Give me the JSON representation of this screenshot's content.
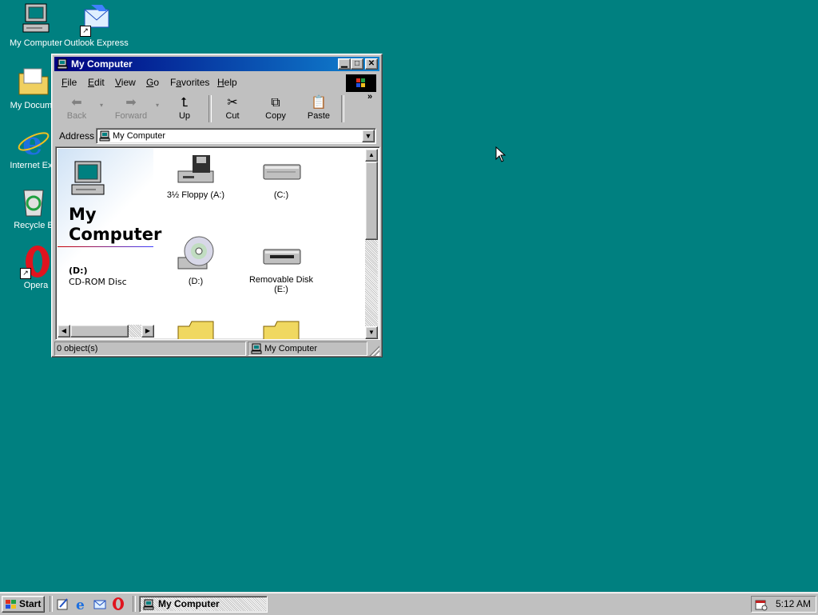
{
  "desktop": {
    "icons": [
      {
        "label": "My Computer",
        "icon": "my-computer-icon"
      },
      {
        "label": "Outlook Express",
        "icon": "outlook-express-icon"
      },
      {
        "label": "My Docume",
        "icon": "my-documents-icon"
      },
      {
        "label": "Internet Exp",
        "icon": "internet-explorer-icon"
      },
      {
        "label": "Recycle B",
        "icon": "recycle-bin-icon"
      },
      {
        "label": "Opera",
        "icon": "opera-icon"
      }
    ]
  },
  "window": {
    "title": "My Computer",
    "menu": [
      "File",
      "Edit",
      "View",
      "Go",
      "Favorites",
      "Help"
    ],
    "menu_underline": [
      "F",
      "E",
      "V",
      "G",
      "a",
      "H"
    ],
    "toolbar": {
      "back": "Back",
      "forward": "Forward",
      "up": "Up",
      "cut": "Cut",
      "copy": "Copy",
      "paste": "Paste",
      "more": "»"
    },
    "address": {
      "label": "Address",
      "value": "My Computer"
    },
    "left_pane": {
      "title": "My Computer",
      "selected_name": "(D:)",
      "selected_desc": "CD-ROM Disc"
    },
    "items": [
      {
        "label": "3½ Floppy (A:)",
        "icon": "floppy-drive-icon"
      },
      {
        "label": "(C:)",
        "icon": "hard-drive-icon"
      },
      {
        "label": "(D:)",
        "icon": "cd-rom-icon"
      },
      {
        "label": "Removable Disk (E:)",
        "icon": "removable-disk-icon"
      },
      {
        "label": "",
        "icon": "printers-folder-icon"
      },
      {
        "label": "",
        "icon": "control-panel-folder-icon"
      }
    ],
    "status": {
      "objects": "0 object(s)",
      "location": "My Computer"
    }
  },
  "taskbar": {
    "start_label": "Start",
    "task_label": "My Computer",
    "clock": "5:12 AM"
  },
  "colors": {
    "desktop": "#008080",
    "titlebar": "#000080",
    "face": "#c0c0c0"
  }
}
